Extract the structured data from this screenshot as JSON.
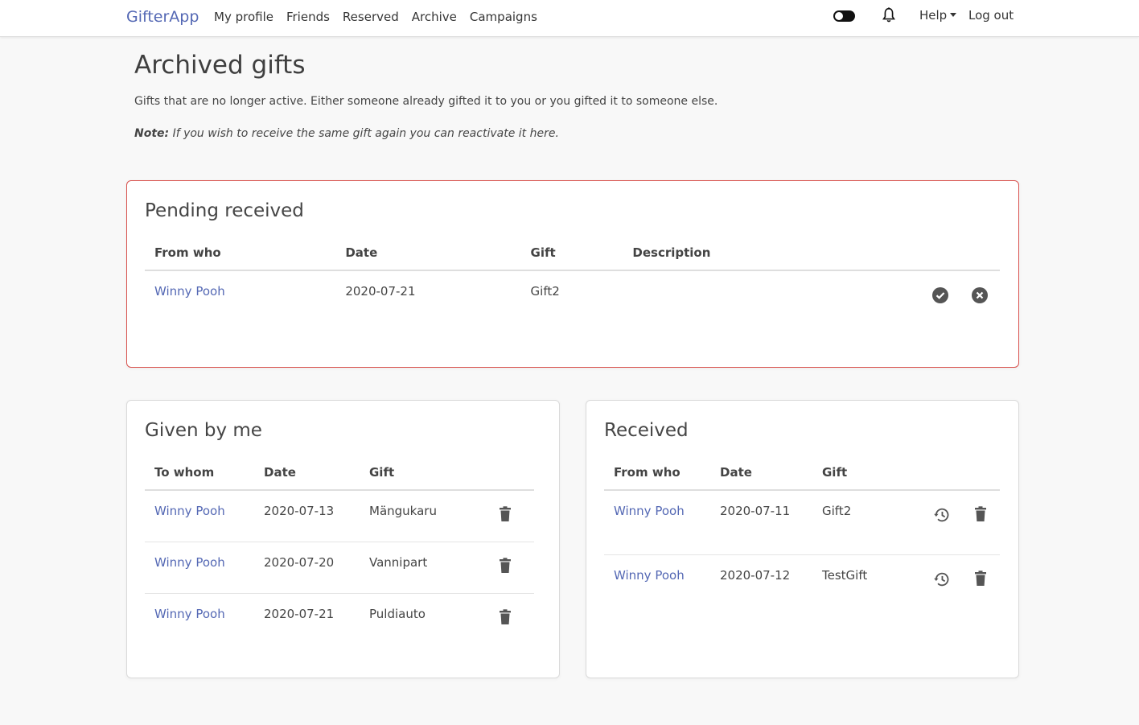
{
  "nav": {
    "brand": "GifterApp",
    "links": [
      "My profile",
      "Friends",
      "Reserved",
      "Archive",
      "Campaigns"
    ],
    "help": "Help",
    "logout": "Log out"
  },
  "page": {
    "title": "Archived gifts",
    "lead": "Gifts that are no longer active. Either someone already gifted it to you or you gifted it to someone else.",
    "note_label": "Note:",
    "note_text": " If you wish to receive the same gift again you can reactivate it here."
  },
  "pending": {
    "title": "Pending received",
    "headers": [
      "From who",
      "Date",
      "Gift",
      "Description"
    ],
    "rows": [
      {
        "from": "Winny Pooh",
        "date": "2020-07-21",
        "gift": "Gift2",
        "description": ""
      }
    ]
  },
  "given": {
    "title": "Given by me",
    "headers": [
      "To whom",
      "Date",
      "Gift"
    ],
    "rows": [
      {
        "to": "Winny Pooh",
        "date": "2020-07-13",
        "gift": "Mängukaru"
      },
      {
        "to": "Winny Pooh",
        "date": "2020-07-20",
        "gift": "Vannipart"
      },
      {
        "to": "Winny Pooh",
        "date": "2020-07-21",
        "gift": "Puldiauto"
      }
    ]
  },
  "received": {
    "title": "Received",
    "headers": [
      "From who",
      "Date",
      "Gift"
    ],
    "rows": [
      {
        "from": "Winny Pooh",
        "date": "2020-07-11",
        "gift": "Gift2"
      },
      {
        "from": "Winny Pooh",
        "date": "2020-07-12",
        "gift": "TestGift"
      }
    ]
  },
  "colors": {
    "brand": "#5468b4",
    "pending_border": "#d9534f",
    "icon": "#555555"
  },
  "icons": [
    "bell-icon",
    "check-circle-icon",
    "cancel-circle-icon",
    "trash-icon",
    "restore-history-icon"
  ]
}
